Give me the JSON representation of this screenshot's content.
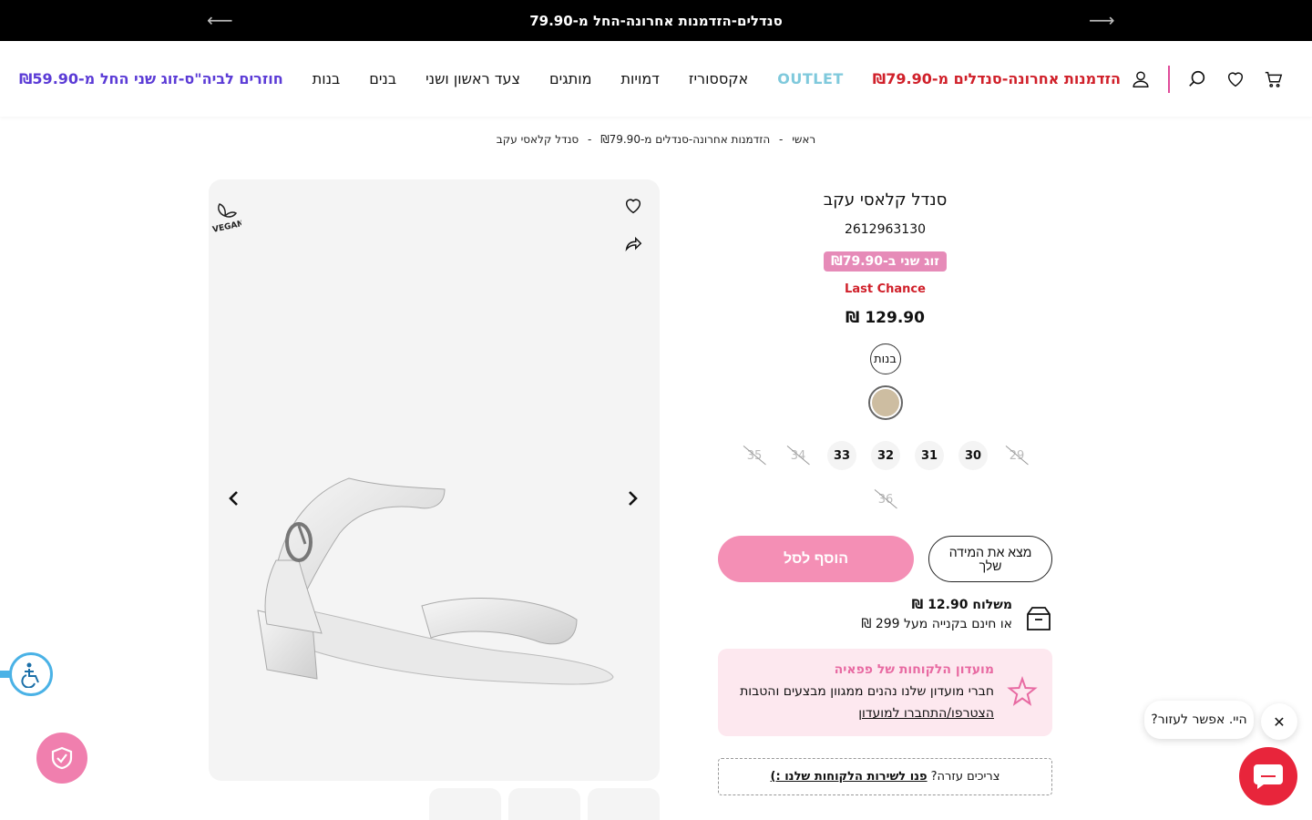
{
  "announcement": {
    "text": "סנדלים-הזדמנות אחרונה-החל מ-79.90"
  },
  "nav": {
    "items": [
      {
        "label": "חוזרים לביה\"ס-זוג שני החל מ-₪59.90",
        "style": "promo"
      },
      {
        "label": "בנות",
        "style": ""
      },
      {
        "label": "בנים",
        "style": ""
      },
      {
        "label": "צעד ראשון ושני",
        "style": ""
      },
      {
        "label": "מותגים",
        "style": ""
      },
      {
        "label": "דמויות",
        "style": ""
      },
      {
        "label": "אקססוריז",
        "style": ""
      },
      {
        "label": "OUTLET",
        "style": "outlet"
      },
      {
        "label": "הזדמנות אחרונה-סנדלים מ-₪79.90",
        "style": "lastchance"
      }
    ]
  },
  "breadcrumb": {
    "home": "ראשי",
    "sep": "-",
    "category": "הזדמנות אחרונה-סנדלים מ-₪79.90",
    "current": "סנדל קלאסי עקב"
  },
  "product": {
    "name": "סנדל קלאסי עקב",
    "sku": "2612963130",
    "badge": "זוג שני ב-₪79.90",
    "last_chance": "Last Chance",
    "price": "129.90 ₪",
    "gender": "בנות",
    "swatch_color": "#cdbda1",
    "sizes": [
      {
        "label": "29",
        "available": false
      },
      {
        "label": "30",
        "available": true
      },
      {
        "label": "31",
        "available": true
      },
      {
        "label": "32",
        "available": true
      },
      {
        "label": "33",
        "available": true
      },
      {
        "label": "34",
        "available": false
      },
      {
        "label": "35",
        "available": false
      },
      {
        "label": "36",
        "available": false
      }
    ],
    "add_to_cart": "הוסף לסל",
    "size_finder": "מצא את המידה שלך"
  },
  "shipping": {
    "title": "משלוח 12.90 ₪",
    "subtitle": "או חינם בקנייה מעל 299 ₪"
  },
  "club": {
    "title": "מועדון הלקוחות של פפאיה",
    "text": "חברי מועדון שלנו נהנים ממגוון מבצעים והטבות",
    "link": "הצטרפו/התחברו למועדון"
  },
  "help": {
    "text": "צריכים עזרה?",
    "link": "פנו לשירות הלקוחות שלנו :)"
  },
  "chat": {
    "bubble": "היי. אפשר לעזור?"
  },
  "colors": {
    "accent_pink": "#f48fb5",
    "promo_purple": "#5b3bd6",
    "outlet_cyan": "#7fc9dc",
    "sale_red": "#d0202a",
    "chat_red": "#e8253b"
  },
  "icons": [
    "cart-icon",
    "heart-icon",
    "search-icon",
    "user-icon",
    "share-icon",
    "vegan-icon",
    "box-icon",
    "star-icon",
    "accessibility-icon",
    "shield-icon",
    "chat-icon",
    "close-icon"
  ]
}
